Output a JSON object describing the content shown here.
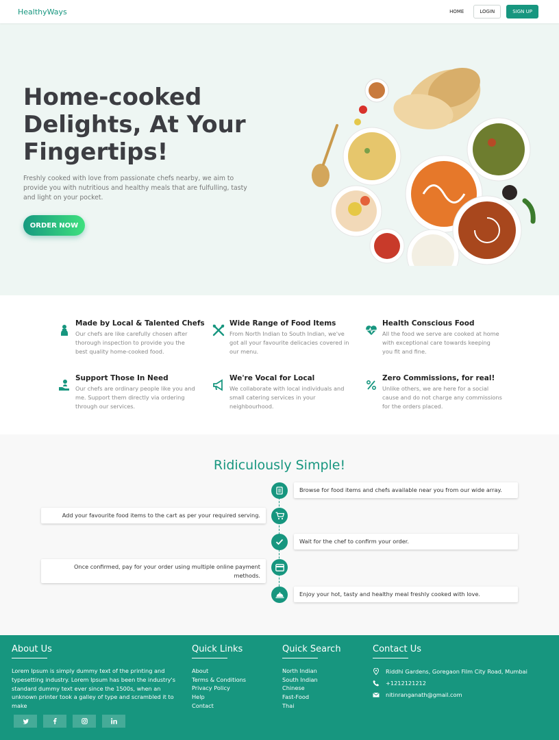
{
  "nav": {
    "brand": "HealthyWays",
    "home": "HOME",
    "login": "LOGIN",
    "signup": "SIGN UP"
  },
  "hero": {
    "title": "Home-cooked Delights, At Your Fingertips!",
    "subtitle": "Freshly cooked with love from passionate chefs nearby, we aim to provide you with nutritious and healthy meals that are fulfulling, tasty and light on your pocket.",
    "cta": "ORDER NOW"
  },
  "features": [
    {
      "icon": "chef-icon",
      "title": "Made by Local & Talented Chefs",
      "desc": "Our chefs are like carefully chosen after thorough inspection to provide you the best quality home-cooked food."
    },
    {
      "icon": "utensils-icon",
      "title": "Wide Range of Food Items",
      "desc": "From North Indian to South Indian, we've got all your favourite delicacies covered in our menu."
    },
    {
      "icon": "heartbeat-icon",
      "title": "Health Conscious Food",
      "desc": "All the food we serve are cooked at home with exceptional care towards keeping you fit and fine."
    },
    {
      "icon": "hand-holding-person-icon",
      "title": "Support Those In Need",
      "desc": "Our chefs are ordinary people like you and me. Support them directly via ordering through our services."
    },
    {
      "icon": "megaphone-icon",
      "title": "We're Vocal for Local",
      "desc": "We collaborate with local individuals and small catering services in your neighbourhood."
    },
    {
      "icon": "percent-icon",
      "title": "Zero Commissions, for real!",
      "desc": "Unlike others, we are here for a social cause and do not charge any commissions for the orders placed."
    }
  ],
  "steps": {
    "title": "Ridiculously Simple!",
    "items": [
      {
        "icon": "menu-book-icon",
        "text": "Browse for food items and chefs available near you from our wide array."
      },
      {
        "icon": "cart-icon",
        "text": "Add your favourite food items to the cart as per your required serving."
      },
      {
        "icon": "check-icon",
        "text": "Wait for the chef to confirm your order."
      },
      {
        "icon": "credit-card-icon",
        "text": "Once confirmed, pay for your order using multiple online payment methods."
      },
      {
        "icon": "cloche-icon",
        "text": "Enjoy your hot, tasty and healthy meal freshly cooked with love."
      }
    ]
  },
  "footer": {
    "about_title": "About Us",
    "about_text": "Lorem Ipsum is simply dummy text of the printing and typesetting industry. Lorem Ipsum has been the industry's standard dummy text ever since the 1500s, when an unknown printer took a galley of type and scrambled it to make",
    "quick_links_title": "Quick Links",
    "quick_links": [
      "About",
      "Terms & Conditions",
      "Privacy Policy",
      "Help",
      "Contact"
    ],
    "quick_search_title": "Quick Search",
    "quick_search": [
      "North Indian",
      "South Indian",
      "Chinese",
      "Fast-Food",
      "Thai"
    ],
    "contact_title": "Contact Us",
    "address": "Riddhi Gardens, Goregaon Film City Road, Mumbai",
    "phone": "+1212121212",
    "email": "nitinranganath@gmail.com",
    "socials": [
      "twitter-icon",
      "facebook-icon",
      "instagram-icon",
      "linkedin-icon"
    ]
  },
  "colors": {
    "accent": "#17967f",
    "hero_bg": "#eef6f3",
    "steps_bg": "#f8f8f8"
  }
}
